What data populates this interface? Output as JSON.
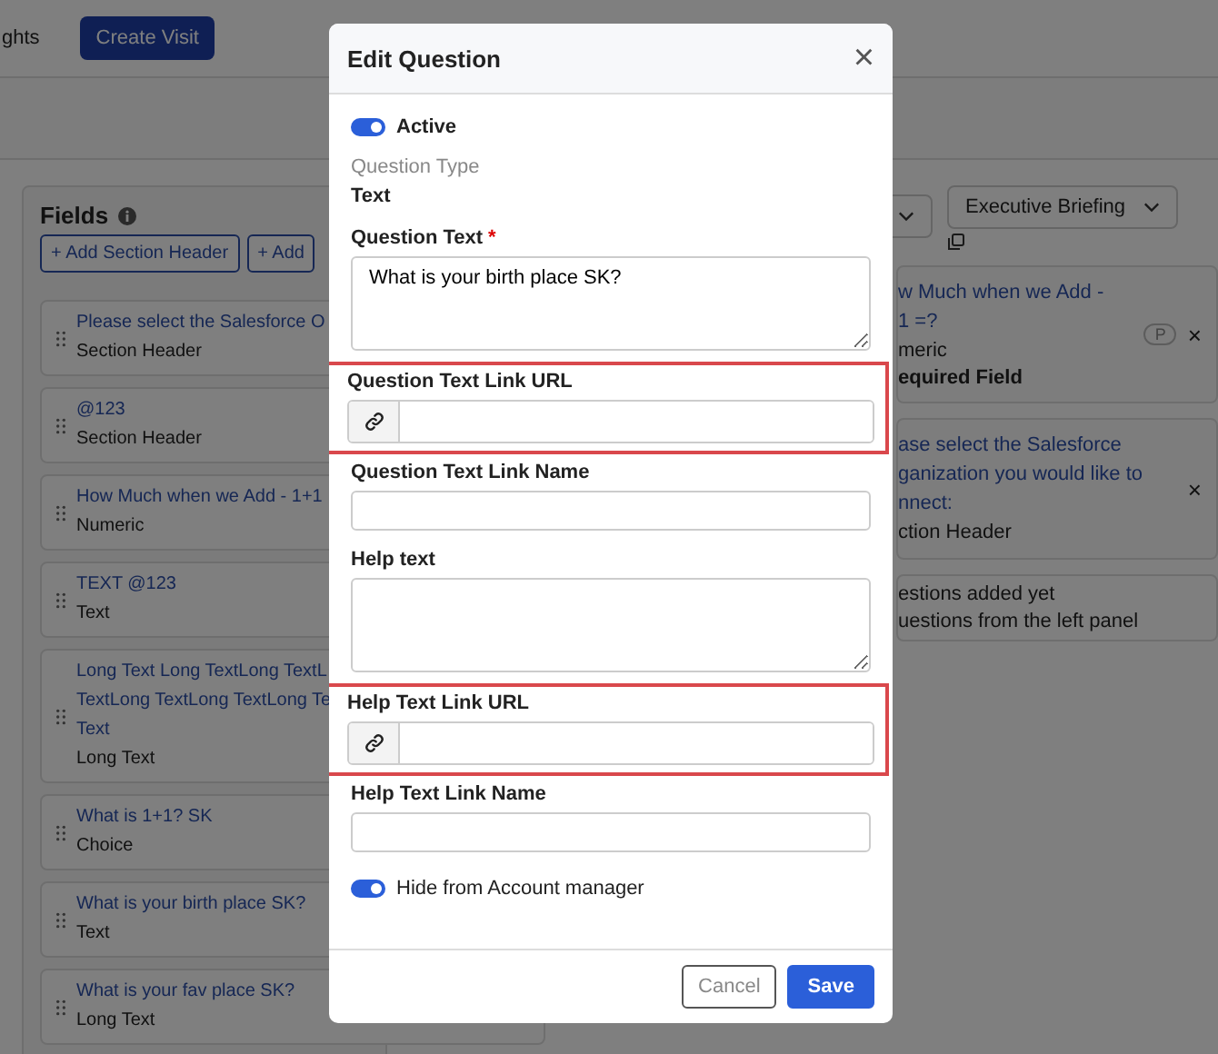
{
  "top_bar": {
    "nav_fragment": "ghts",
    "create_button": "Create Visit"
  },
  "fields_panel": {
    "title": "Fields",
    "add_buttons": [
      "+ Add Section Header",
      "+ Add"
    ],
    "items": [
      {
        "title_lines": [
          "Please select the Salesforce O"
        ],
        "type": "Section Header"
      },
      {
        "title_lines": [
          "@123"
        ],
        "type": "Section Header"
      },
      {
        "title_lines": [
          "How Much when we Add - 1+1"
        ],
        "type": "Numeric"
      },
      {
        "title_lines": [
          "TEXT @123"
        ],
        "type": "Text"
      },
      {
        "title_lines": [
          "Long Text Long TextLong TextL",
          "TextLong TextLong TextLong Te",
          "Text"
        ],
        "type": "Long Text"
      },
      {
        "title_lines": [
          "What is 1+1? SK"
        ],
        "type": "Choice"
      },
      {
        "title_lines": [
          "What is your birth place SK?"
        ],
        "type": "Text"
      },
      {
        "title_lines": [
          "What is your fav place SK?"
        ],
        "type": "Long Text"
      }
    ]
  },
  "right_panel": {
    "dropdown": "Executive Briefing",
    "items": [
      {
        "kind": "question",
        "title_lines": [
          "w Much when we Add -",
          "1 =?"
        ],
        "type": "meric",
        "note": "equired Field",
        "badge": "P",
        "close": "×"
      },
      {
        "kind": "question",
        "title_lines": [
          "ase select the Salesforce",
          "ganization you would like to",
          "nnect:"
        ],
        "type": "ction Header",
        "close": "×"
      },
      {
        "kind": "empty",
        "lines": [
          "estions added yet",
          "uestions from the left panel"
        ]
      }
    ]
  },
  "modal": {
    "title": "Edit Question",
    "close": "×",
    "required_mark": "*",
    "active": {
      "label": "Active",
      "on": true
    },
    "question_type": {
      "label": "Question Type",
      "value": "Text"
    },
    "fields": [
      {
        "kind": "textarea",
        "label": "Question Text",
        "required": true,
        "value": "What is your birth place SK?",
        "highlighted": false
      },
      {
        "kind": "link",
        "label": "Question Text Link URL",
        "required": false,
        "highlighted": true
      },
      {
        "kind": "input",
        "label": "Question Text Link Name",
        "required": false,
        "highlighted": false
      },
      {
        "kind": "textarea",
        "label": "Help text",
        "required": false,
        "highlighted": false
      },
      {
        "kind": "link",
        "label": "Help Text Link URL",
        "required": false,
        "highlighted": true
      },
      {
        "kind": "input",
        "label": "Help Text Link Name",
        "required": false,
        "highlighted": false
      }
    ],
    "hide_toggle": {
      "label": "Hide from Account manager",
      "on": true
    },
    "buttons": [
      {
        "label": "Cancel",
        "kind": "secondary"
      },
      {
        "label": "Save",
        "kind": "primary"
      }
    ]
  }
}
